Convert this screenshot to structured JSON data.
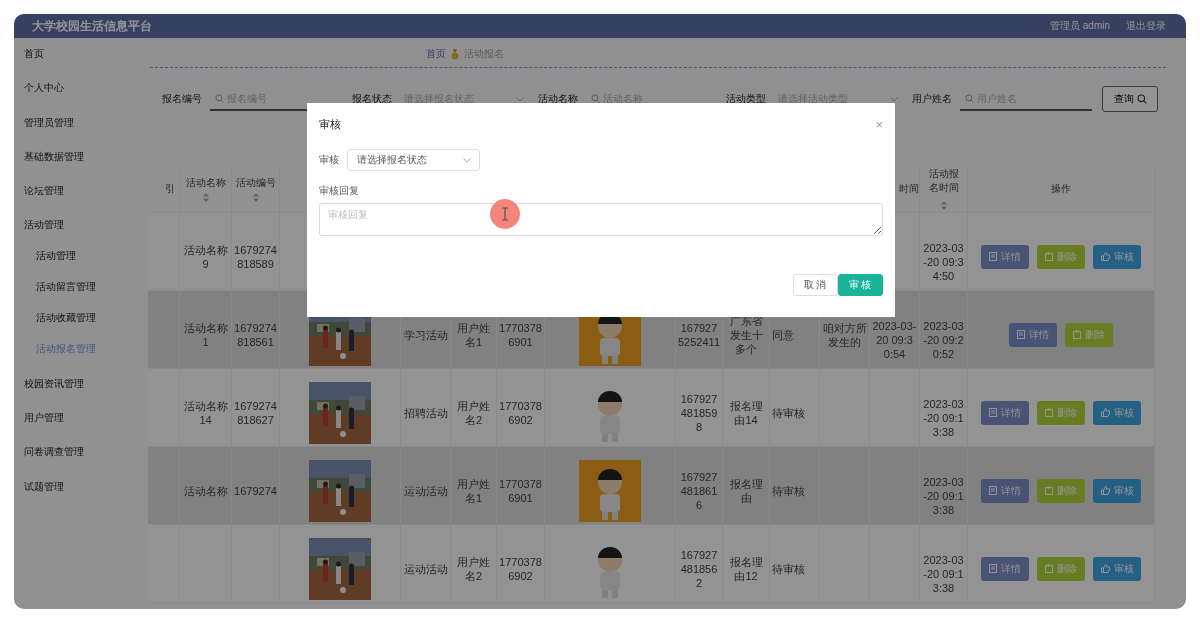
{
  "header": {
    "title": "大学校园生活信息平台",
    "user": "管理员 admin",
    "logout": "退出登录"
  },
  "sidebar": {
    "items": [
      {
        "label": "首页",
        "selected": false
      },
      {
        "label": "个人中心",
        "selected": false
      },
      {
        "label": "管理员管理",
        "selected": false
      },
      {
        "label": "基础数据管理",
        "selected": false
      },
      {
        "label": "论坛管理",
        "selected": false
      },
      {
        "label": "活动管理",
        "selected": false,
        "children": [
          {
            "label": "活动管理",
            "selected": false
          },
          {
            "label": "活动留言管理",
            "selected": false
          },
          {
            "label": "活动收藏管理",
            "selected": false
          },
          {
            "label": "活动报名管理",
            "selected": true
          }
        ]
      },
      {
        "label": "校园资讯管理",
        "selected": false
      },
      {
        "label": "用户管理",
        "selected": false
      },
      {
        "label": "问卷调查管理",
        "selected": false
      },
      {
        "label": "试题管理",
        "selected": false
      }
    ]
  },
  "breadcrumb": [
    "首页",
    "活动报名"
  ],
  "filters": [
    {
      "label": "报名编号",
      "kind": "search",
      "placeholder": "报名编号"
    },
    {
      "label": "报名状态",
      "kind": "select",
      "placeholder": "请选择报名状态"
    },
    {
      "label": "活动名称",
      "kind": "search",
      "placeholder": "活动名称"
    },
    {
      "label": "活动类型",
      "kind": "select",
      "placeholder": "请选择活动类型"
    },
    {
      "label": "用户姓名",
      "kind": "search",
      "placeholder": "用户姓名"
    }
  ],
  "query_button": "查询",
  "table": {
    "columns_left": [
      {
        "label": "引"
      },
      {
        "label": "活动名称",
        "sortable": true
      },
      {
        "label": "活动编号",
        "sortable": true
      }
    ],
    "columns_right": [
      {
        "label": "时间"
      },
      {
        "label": "活动报名时间",
        "sortable": true
      },
      {
        "label": "操作"
      }
    ],
    "rows": [
      {
        "striped": false,
        "activity_name": "活动名称9",
        "activity_no": "1679274818589",
        "signup_time": "2023-03-20 09:34:50",
        "actions": [
          {
            "label": "详情",
            "kind": "detail"
          },
          {
            "label": "删除",
            "kind": "delete"
          },
          {
            "label": "审核",
            "kind": "review"
          }
        ]
      },
      {
        "striped": true,
        "activity_name": "活动名称1",
        "activity_no": "1679274818561",
        "photo": {
          "kind": "picture"
        },
        "activity_type": "学习活动",
        "user_name": "用户姓名1",
        "phone": "17703786901",
        "avatar": {
          "kind": "tile"
        },
        "signup_no": "1679275252411",
        "reason": "广东省发生十多个",
        "status": "同意",
        "reply": "咱对方所发生的",
        "review_time": "2023-03-20 09:30:54",
        "signup_time": "2023-03-20 09:20:52",
        "actions": [
          {
            "label": "详情",
            "kind": "detail"
          },
          {
            "label": "删除",
            "kind": "delete"
          }
        ]
      },
      {
        "striped": false,
        "activity_name": "活动名称14",
        "activity_no": "1679274818627",
        "photo": {
          "kind": "picture"
        },
        "activity_type": "招聘活动",
        "user_name": "用户姓名2",
        "phone": "17703786902",
        "avatar": {
          "kind": "cutout"
        },
        "signup_no": "1679274818598",
        "reason": "报名理由14",
        "status": "待审核",
        "signup_time": "2023-03-20 09:13:38",
        "actions": [
          {
            "label": "详情",
            "kind": "detail"
          },
          {
            "label": "删除",
            "kind": "delete"
          },
          {
            "label": "审核",
            "kind": "review"
          }
        ]
      },
      {
        "striped": true,
        "activity_name": "活动名称",
        "activity_no": "1679274",
        "photo": {
          "kind": "picture"
        },
        "activity_type": "运动活动",
        "user_name": "用户姓名1",
        "phone": "17703786901",
        "avatar": {
          "kind": "tile"
        },
        "signup_no": "1679274818616",
        "reason": "报名理由",
        "status": "待审核",
        "signup_time": "2023-03-20 09:13:38",
        "actions": [
          {
            "label": "详情",
            "kind": "detail"
          },
          {
            "label": "删除",
            "kind": "delete"
          },
          {
            "label": "审核",
            "kind": "review"
          }
        ]
      },
      {
        "striped": false,
        "photo": {
          "kind": "picture"
        },
        "activity_type": "运动活动",
        "user_name": "用户姓名2",
        "phone": "17703786902",
        "avatar": {
          "kind": "cutout"
        },
        "signup_no": "1679274818562",
        "reason": "报名理由12",
        "status": "待审核",
        "signup_time": "2023-03-20 09:13:38",
        "actions": [
          {
            "label": "详情",
            "kind": "detail"
          },
          {
            "label": "删除",
            "kind": "delete"
          },
          {
            "label": "审核",
            "kind": "review"
          }
        ]
      }
    ]
  },
  "dialog": {
    "title": "审核",
    "close": "×",
    "status_label": "审核",
    "status_placeholder": "请选择报名状态",
    "reply_label": "审核回复",
    "reply_placeholder": "审核回复",
    "buttons": [
      {
        "label": "取消",
        "kind": "cancel"
      },
      {
        "label": "审核",
        "kind": "primary"
      }
    ]
  }
}
